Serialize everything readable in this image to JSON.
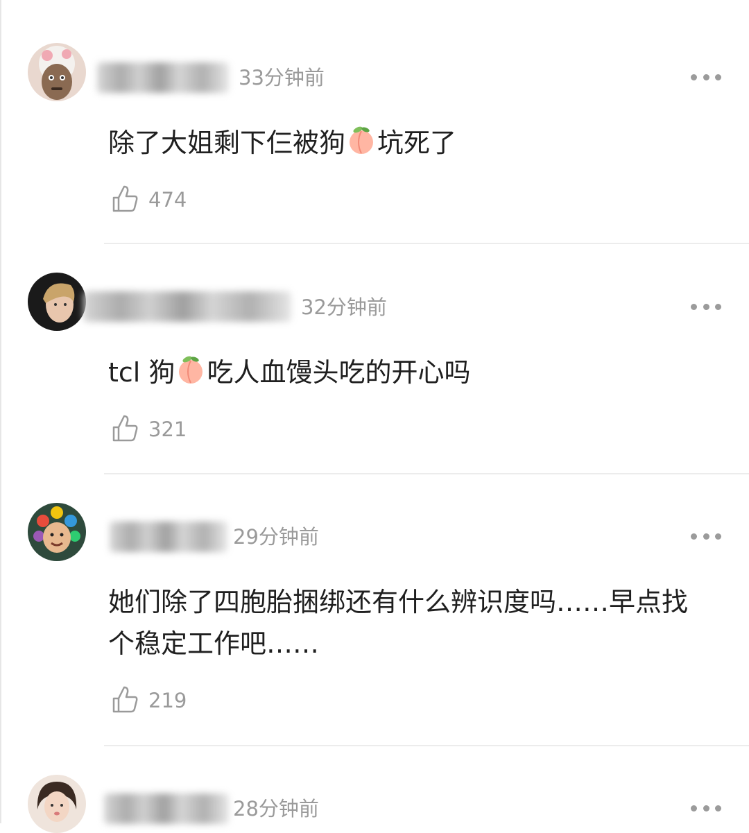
{
  "comments": [
    {
      "time": "33分钟前",
      "text_parts": [
        "除了大姐剩下仨被狗",
        "坑死了"
      ],
      "likes": "474"
    },
    {
      "time": "32分钟前",
      "text_parts": [
        "tcl 狗",
        "吃人血馒头吃的开心吗"
      ],
      "likes": "321"
    },
    {
      "time": "29分钟前",
      "text_lines": [
        "她们除了四胞胎捆绑还有什么辨识度吗……早点找",
        "个稳定工作吧……"
      ],
      "likes": "219"
    },
    {
      "time": "28分钟前"
    }
  ],
  "icons": {
    "like": "thumbs-up-icon",
    "more": "more-icon",
    "emoji": "peach-emoji-icon"
  },
  "colors": {
    "meta_text": "#9a9a9a",
    "body_text": "#1f1f1f",
    "divider": "#ececec"
  }
}
